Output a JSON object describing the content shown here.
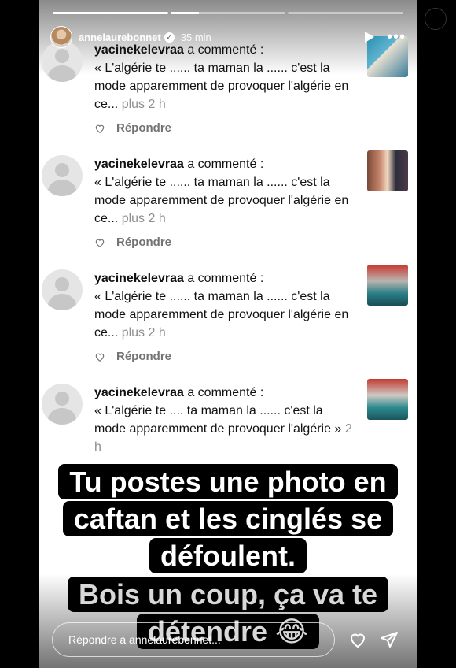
{
  "story": {
    "username": "annelaurebonnet",
    "time": "35 min",
    "progress": [
      1.0,
      0.25,
      0.0
    ]
  },
  "comments": [
    {
      "user": "yacinekelevraa",
      "action": "a commenté :",
      "text": "« L'algérie te ...... ta maman la ...... c'est la mode apparemment de provoquer l'algérie en ce...",
      "more": "plus",
      "ago": "2 h",
      "reply": "Répondre"
    },
    {
      "user": "yacinekelevraa",
      "action": "a commenté :",
      "text": "« L'algérie te ...... ta maman la ...... c'est la mode apparemment de provoquer l'algérie en ce...",
      "more": "plus",
      "ago": "2 h",
      "reply": "Répondre"
    },
    {
      "user": "yacinekelevraa",
      "action": "a commenté :",
      "text": "« L'algérie te ...... ta maman la ...... c'est la mode apparemment de provoquer l'algérie en ce...",
      "more": "plus",
      "ago": "2 h",
      "reply": "Répondre"
    },
    {
      "user": "yacinekelevraa",
      "action": "a commenté :",
      "text": "« L'algérie te .... ta maman la ...... c'est la mode apparemment de provoquer l'algérie »",
      "more": "",
      "ago": "2 h",
      "reply": ""
    }
  ],
  "captions": {
    "main": "Tu postes une photo en caftan et les cinglés se défoulent.",
    "second": "Bois un coup, ça va te détendre 😂"
  },
  "reply_bar": {
    "placeholder": "Répondre à annelaurebonnet..."
  },
  "colors": {
    "muted": "#8e8e8e",
    "caption_bg": "#000000"
  }
}
